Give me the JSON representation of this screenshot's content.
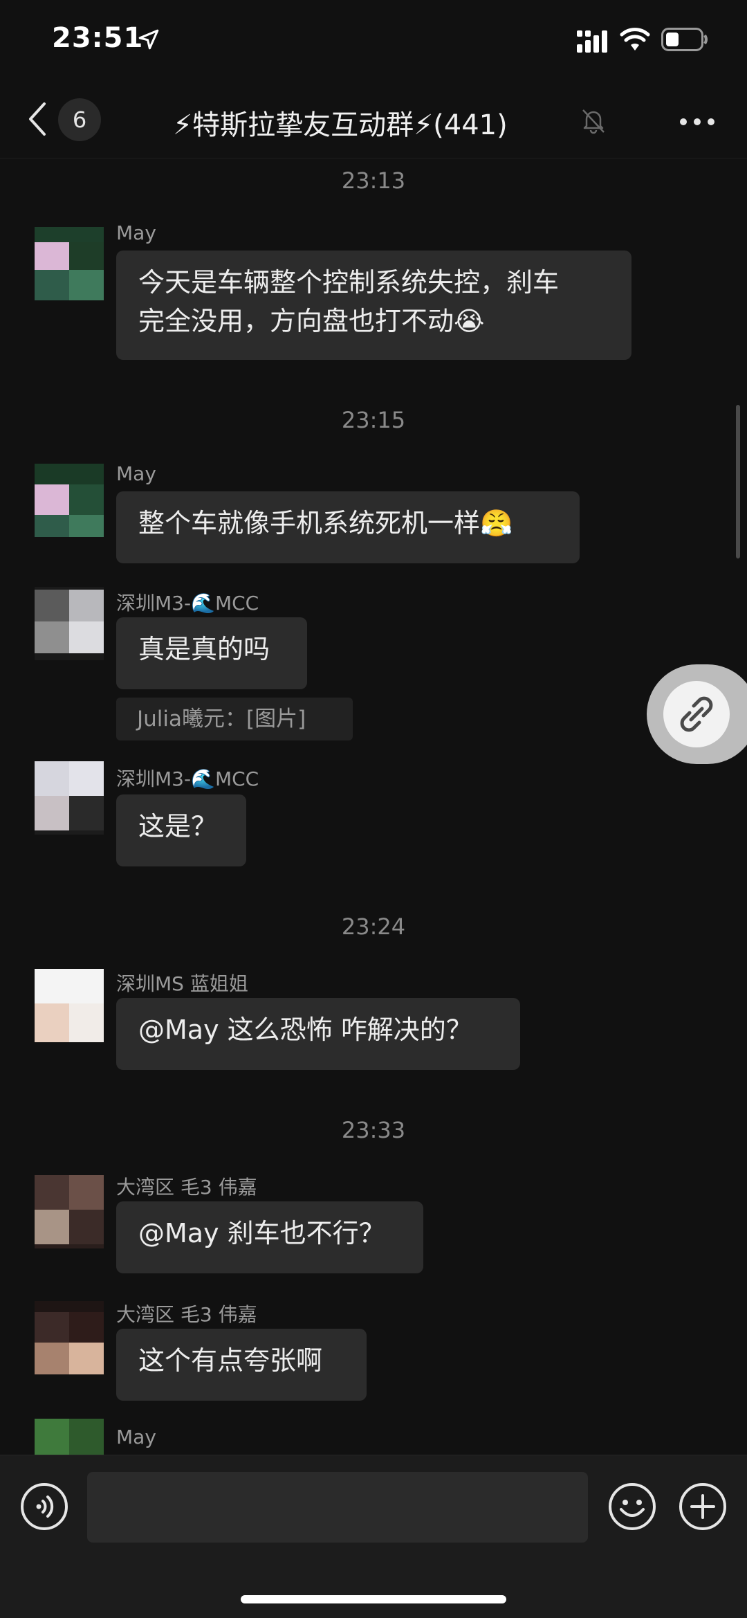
{
  "status_bar": {
    "time": "23:51"
  },
  "nav": {
    "unread_count": "6",
    "title": "⚡特斯拉挚友互动群⚡(441)"
  },
  "messages": [
    {
      "timestamp": "23:13",
      "sender": "May",
      "line1": "今天是车辆整个控制系统失控，刹车",
      "line2": "完全没用，方向盘也打不动😭"
    },
    {
      "timestamp": "23:15",
      "sender": "May",
      "text": "整个车就像手机系统死机一样😤"
    },
    {
      "sender": "深圳M3-🌊MCC",
      "text": "真是真的吗",
      "quote": "Julia曦元：[图片]"
    },
    {
      "sender": "深圳M3-🌊MCC",
      "text": "这是？"
    },
    {
      "timestamp": "23:24",
      "sender": "深圳MS 蓝姐姐",
      "text": "@May 这么恐怖 咋解决的？"
    },
    {
      "timestamp": "23:33",
      "sender": "大湾区 毛3 伟嘉",
      "text": "@May 刹车也不行？"
    },
    {
      "sender": "大湾区 毛3 伟嘉",
      "text": "这个有点夸张啊"
    },
    {
      "sender": "May"
    }
  ],
  "input": {
    "placeholder": ""
  },
  "icons": {
    "back": "chevron-left-icon",
    "mute": "bell-slash-icon",
    "more": "ellipsis-icon",
    "voice": "voice-icon",
    "emoji": "emoji-icon",
    "plus": "plus-icon",
    "link": "link-icon"
  },
  "colors": {
    "background": "#111111",
    "bubble": "#2c2c2c",
    "input_bar": "#1c1c1c"
  }
}
